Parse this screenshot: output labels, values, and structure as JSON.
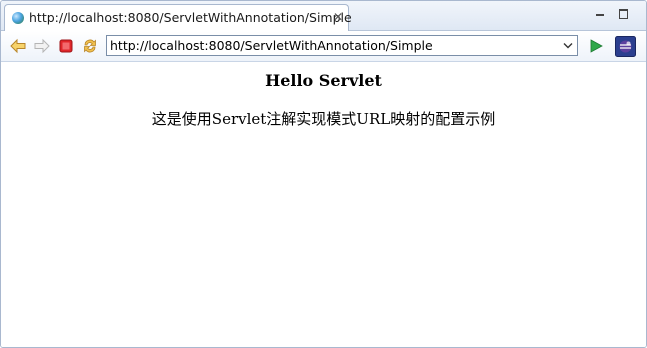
{
  "tab": {
    "title": "http://localhost:8080/ServletWithAnnotation/Simple",
    "icon": "globe-icon",
    "close_glyph": "✕"
  },
  "window": {
    "minimize_icon": "minimize-icon",
    "maximize_icon": "maximize-icon"
  },
  "toolbar": {
    "back_icon": "back-arrow-icon",
    "forward_icon": "forward-arrow-icon",
    "stop_icon": "stop-icon",
    "refresh_icon": "refresh-icon",
    "go_icon": "go-arrow-icon",
    "eclipse_icon": "eclipse-icon"
  },
  "address_bar": {
    "value": "http://localhost:8080/ServletWithAnnotation/Simple"
  },
  "page": {
    "heading": "Hello Servlet",
    "text": "这是使用Servlet注解实现模式URL映射的配置示例"
  },
  "colors": {
    "accent": "#4aa3df",
    "stop": "#e0262a",
    "go": "#2fa84a",
    "tabbar_bg": "#dfe8f4"
  }
}
